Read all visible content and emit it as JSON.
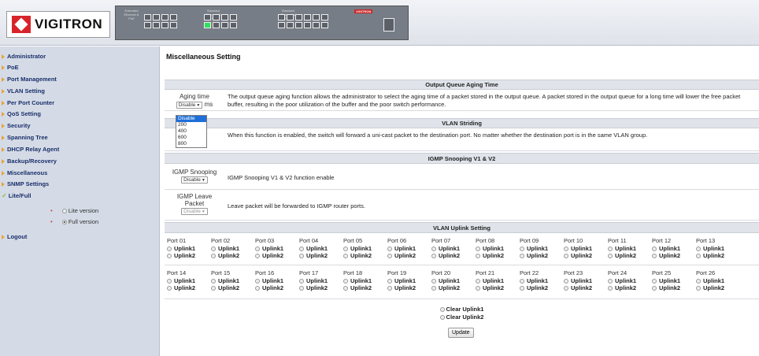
{
  "brand": {
    "logo_text": "VIGITRON",
    "panel_badge": "VIGITRON"
  },
  "panel": {
    "labels": [
      "Extended Ethernet & PoE",
      "Standard Ethernet & PoE",
      "Standard Ethernet & PoE"
    ]
  },
  "sidebar": {
    "items": [
      {
        "label": "Administrator"
      },
      {
        "label": "PoE"
      },
      {
        "label": "Port Management"
      },
      {
        "label": "VLAN Setting"
      },
      {
        "label": "Per Port Counter"
      },
      {
        "label": "QoS Setting"
      },
      {
        "label": "Security"
      },
      {
        "label": "Spanning Tree"
      },
      {
        "label": "DHCP Relay Agent"
      },
      {
        "label": "Backup/Recovery"
      },
      {
        "label": "Miscellaneous"
      },
      {
        "label": "SNMP Settings"
      },
      {
        "label": "Lite/Full"
      }
    ],
    "lite_label": "Lite version",
    "full_label": "Full version",
    "selected_version": "Full version",
    "logout": "Logout"
  },
  "main": {
    "title": "Miscellaneous Setting",
    "output_queue": {
      "header": "Output Queue Aging Time",
      "caption": "Aging time",
      "unit": "ms",
      "select_value": "Disable",
      "dropdown_options": [
        "Disable",
        "200",
        "400",
        "600",
        "800"
      ],
      "dropdown_highlight": "Disable",
      "description": "The output queue aging function allows the administrator to select the aging time of a packet stored in the output queue. A packet stored in the output queue for a long time will lower the free packet buffer, resulting in the poor utilization of the buffer and the poor switch performance."
    },
    "vlan_striding": {
      "header": "VLAN Striding",
      "caption_partial": "ding",
      "description": "When this function is enabled, the switch will forward a uni-cast packet to the destination port. No matter whether the destination port is in the same VLAN group."
    },
    "igmp": {
      "header": "IGMP Snooping V1 & V2",
      "snooping_caption": "IGMP Snooping",
      "snooping_value": "Disable",
      "snooping_desc": "IGMP Snooping V1 & V2 function enable",
      "leave_caption_1": "IGMP Leave",
      "leave_caption_2": "Packet",
      "leave_value": "Disable",
      "leave_desc": "Leave packet will be forwarded to IGMP router ports."
    },
    "uplink": {
      "header": "VLAN Uplink Setting",
      "uplink1": "Uplink1",
      "uplink2": "Uplink2",
      "ports_row1": [
        "Port 01",
        "Port 02",
        "Port 03",
        "Port 04",
        "Port 05",
        "Port 06",
        "Port 07",
        "Port 08",
        "Port 09",
        "Port 10",
        "Port 11",
        "Port 12",
        "Port 13"
      ],
      "ports_row2": [
        "Port 14",
        "Port 15",
        "Port 16",
        "Port 17",
        "Port 18",
        "Port 19",
        "Port 20",
        "Port 21",
        "Port 22",
        "Port 23",
        "Port 24",
        "Port 25",
        "Port 26"
      ],
      "clear1": "Clear Uplink1",
      "clear2": "Clear Uplink2"
    },
    "update_button": "Update"
  }
}
